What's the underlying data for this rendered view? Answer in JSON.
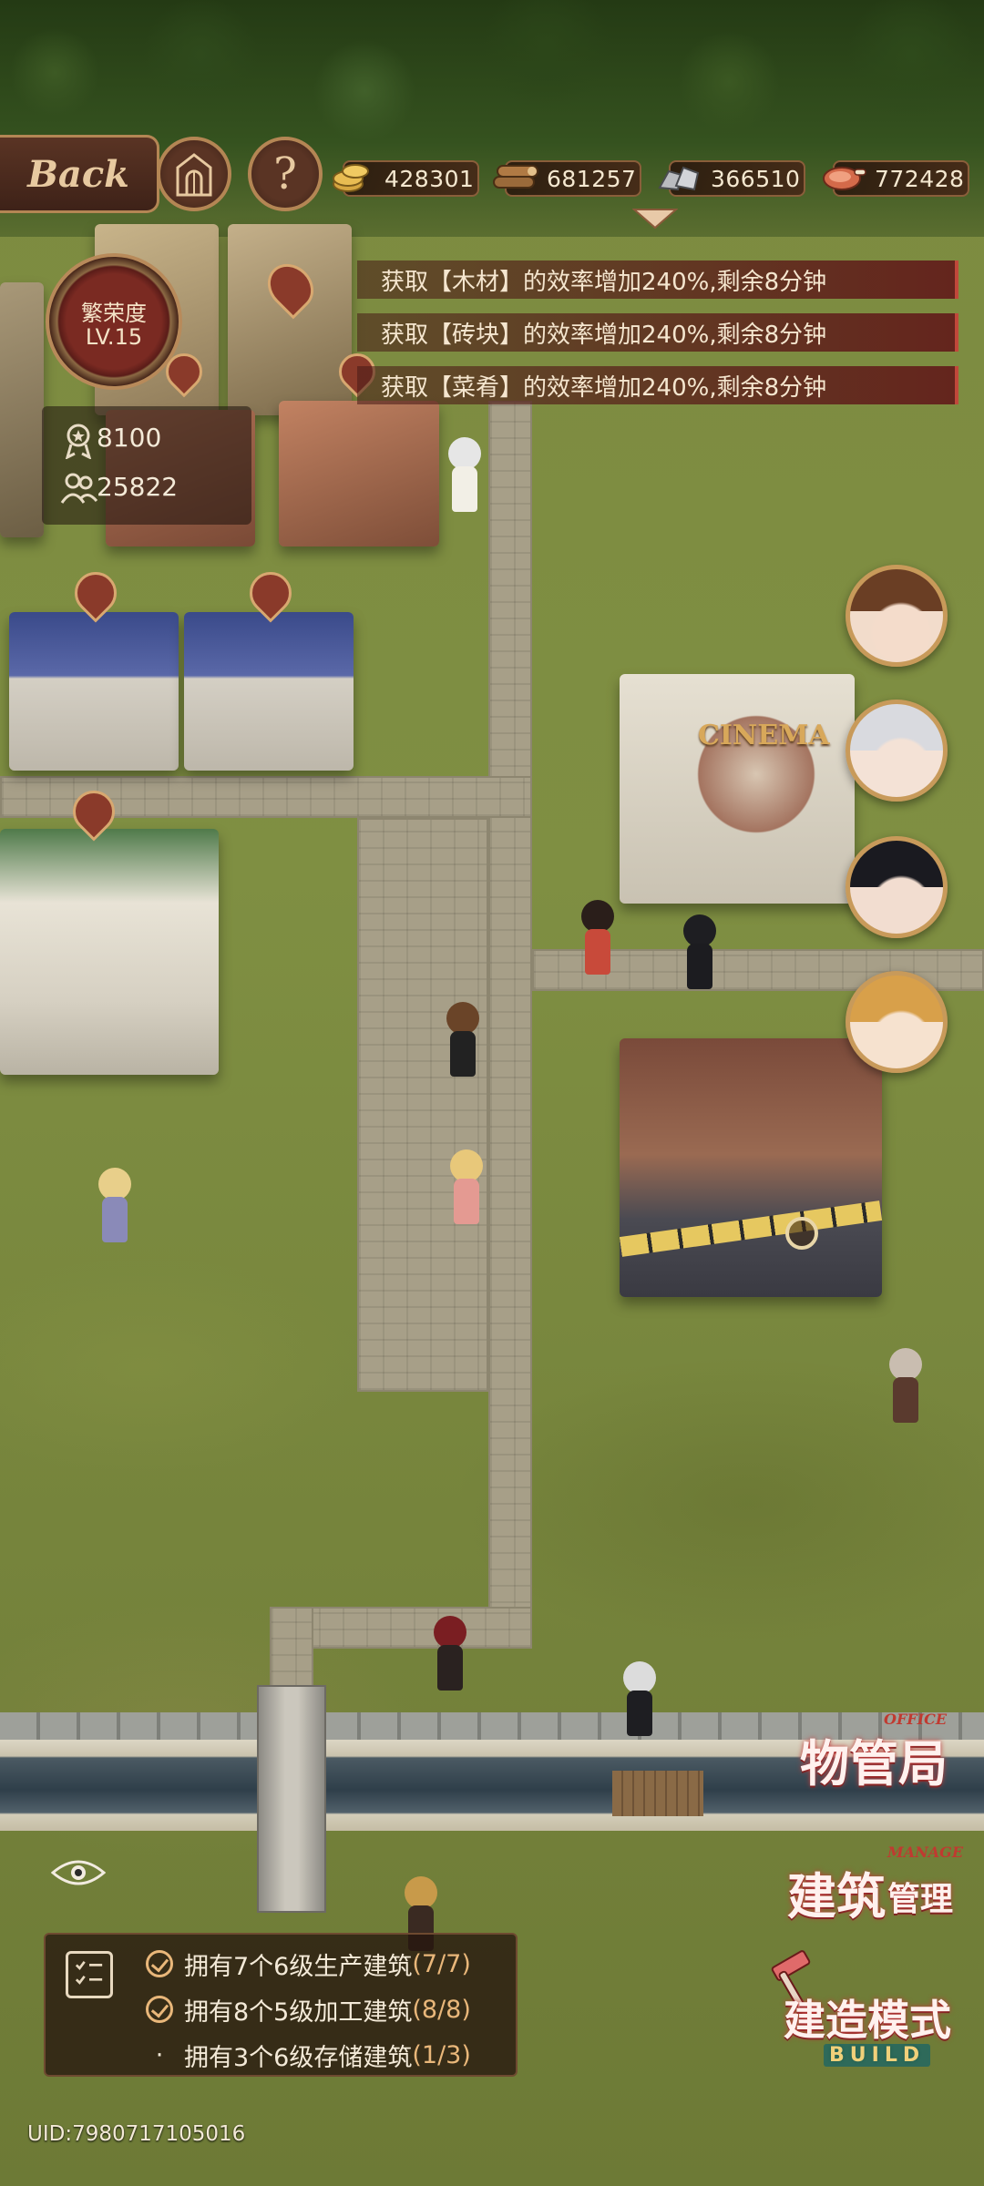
{
  "hud": {
    "back_label": "Back",
    "home_icon": "castle-gate-icon",
    "help_label": "?"
  },
  "resources": [
    {
      "icon": "gold-coins-icon",
      "value": "428301"
    },
    {
      "icon": "wood-logs-icon",
      "value": "681257"
    },
    {
      "icon": "stone-bricks-icon",
      "value": "366510"
    },
    {
      "icon": "food-meat-icon",
      "value": "772428"
    }
  ],
  "buffs": [
    "获取【木材】的效率增加240%,剩余8分钟",
    "获取【砖块】的效率增加240%,剩余8分钟",
    "获取【菜肴】的效率增加240%,剩余8分钟"
  ],
  "prosperity": {
    "label": "繁荣度",
    "level": "LV.15"
  },
  "stats": {
    "reputation": "8100",
    "population": "25822"
  },
  "map": {
    "cinema_sign": "CINEMA"
  },
  "side_buttons": {
    "office": {
      "label": "物管局",
      "tag": "OFFICE"
    },
    "manage": {
      "label_big": "建筑",
      "label_small": "管理",
      "tag": "MANAGE"
    },
    "build": {
      "label": "建造模式",
      "tag": "BUILD"
    }
  },
  "quests": [
    {
      "text": "拥有7个6级生产建筑",
      "progress": "(7/7)",
      "done": true
    },
    {
      "text": "拥有8个5级加工建筑",
      "progress": "(8/8)",
      "done": true
    },
    {
      "text": "拥有3个6级存储建筑",
      "progress": "(1/3)",
      "done": false
    }
  ],
  "uid": "UID:7980717105016",
  "colors": {
    "accent_gold": "#b48654",
    "buff_red": "#c0483a",
    "quest_progress": "#e9b77a",
    "button_red": "#c33a3a"
  }
}
